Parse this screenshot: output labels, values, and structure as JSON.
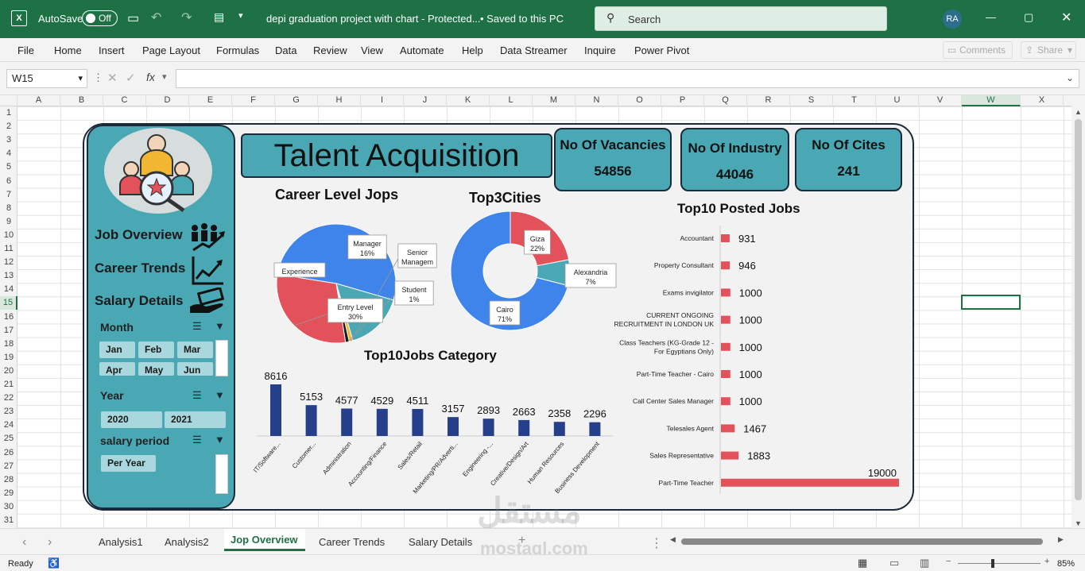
{
  "titlebar": {
    "autosave_label": "AutoSave",
    "toggle_label": "Off",
    "filename": "depi graduation project with chart  -  Protected...",
    "save_status": "• Saved to this PC",
    "search_placeholder": "Search",
    "user_initials": "RA"
  },
  "ribbon": {
    "menus": [
      "File",
      "Home",
      "Insert",
      "Page Layout",
      "Formulas",
      "Data",
      "Review",
      "View",
      "Automate",
      "Help",
      "Data Streamer",
      "Inquire",
      "Power Pivot"
    ],
    "comments_label": "Comments",
    "share_label": "Share"
  },
  "formula_bar": {
    "name_box": "W15",
    "fx_label": "fx",
    "formula": ""
  },
  "columns": [
    "A",
    "B",
    "C",
    "D",
    "E",
    "F",
    "G",
    "H",
    "I",
    "J",
    "K",
    "L",
    "M",
    "N",
    "O",
    "P",
    "Q",
    "R",
    "S",
    "T",
    "U",
    "V",
    "W",
    "X"
  ],
  "rows": [
    "1",
    "2",
    "3",
    "4",
    "5",
    "6",
    "7",
    "8",
    "9",
    "10",
    "11",
    "12",
    "13",
    "14",
    "15",
    "16",
    "17",
    "18",
    "19",
    "20",
    "21",
    "22",
    "23",
    "24",
    "25",
    "26",
    "27",
    "28",
    "29",
    "30",
    "31"
  ],
  "dashboard": {
    "title": "Talent Acquisition",
    "kpis": [
      {
        "label": "No Of  Vacancies",
        "value": "54856"
      },
      {
        "label": "No Of  Industry",
        "value": "44046"
      },
      {
        "label": "No Of Cites",
        "value": "241"
      }
    ],
    "nav": [
      "Job Overview",
      "Career Trends",
      "Salary Details"
    ],
    "slicers": {
      "month": {
        "header": "Month",
        "items": [
          "Jan",
          "Feb",
          "Mar",
          "Apr",
          "May",
          "Jun"
        ]
      },
      "year": {
        "header": "Year",
        "items": [
          "2020",
          "2021"
        ]
      },
      "salary_period": {
        "header": "salary period",
        "items": [
          "Per Year"
        ]
      }
    },
    "career_title": "Career Level Jops",
    "cities_title": "Top3Cities",
    "category_title": "Top10Jobs Category",
    "posted_title": "Top10 Posted Jobs"
  },
  "chart_data": [
    {
      "type": "pie",
      "title": "Career Level Jops",
      "labels": [
        "Experience",
        "Manager",
        "Senior Managem",
        "Student",
        "Entry Level"
      ],
      "percent_labels": [
        "",
        "16%",
        "",
        "1%",
        "30%"
      ],
      "values": [
        52,
        16,
        1,
        1,
        30
      ],
      "colors": [
        "#3f84ea",
        "#4aa8b4",
        "#f2b732",
        "#1a1a1a",
        "#e3525a"
      ]
    },
    {
      "type": "pie",
      "title": "Top3Cities",
      "labels": [
        "Giza",
        "Alexandria",
        "Cairo"
      ],
      "percent_labels": [
        "22%",
        "7%",
        "71%"
      ],
      "values": [
        22,
        7,
        71
      ],
      "colors": [
        "#e3525a",
        "#4aa8b4",
        "#3f84ea"
      ]
    },
    {
      "type": "bar",
      "title": "Top10Jobs Category",
      "categories": [
        "IT/Software...",
        "Customer...",
        "Administration",
        "Accounting/Finance",
        "Sales/Retail",
        "Marketing/PR/Adverti...",
        "Engineering -...",
        "Creative/Design/Art",
        "Human Resources",
        "Business Development"
      ],
      "values": [
        8616,
        5153,
        4577,
        4529,
        4511,
        3157,
        2893,
        2663,
        2358,
        2296
      ],
      "color": "#253f8a"
    },
    {
      "type": "bar",
      "orientation": "horizontal",
      "title": "Top10 Posted Jobs",
      "categories": [
        "Accountant",
        "Property Consultant",
        "Exams invigilator",
        "CURRENT ONGOING RECRUITMENT IN LONDON UK",
        "Class Teachers (KG-Grade 12 - For Egyptians Only)",
        "Part-Time Teacher - Cairo",
        "Call Center Sales Manager",
        "Telesales Agent",
        "Sales Representative",
        "Part-Time Teacher"
      ],
      "values": [
        931,
        946,
        1000,
        1000,
        1000,
        1000,
        1000,
        1467,
        1883,
        19000
      ],
      "color": "#e3525a"
    }
  ],
  "sheet_tabs": [
    "Analysis1",
    "Analysis2",
    "Jop Overview",
    "Career Trends",
    "Salary Details"
  ],
  "active_tab": "Jop Overview",
  "status": {
    "ready": "Ready",
    "zoom": "85%"
  },
  "watermark": {
    "arabic": "مستقل",
    "latin": "mostaql.com"
  }
}
